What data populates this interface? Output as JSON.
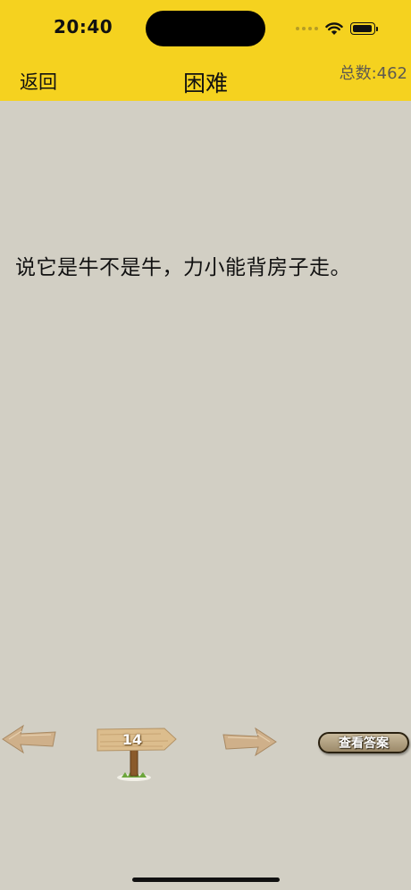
{
  "status_bar": {
    "time": "20:40"
  },
  "nav": {
    "back_label": "返回",
    "title": "困难",
    "total_label": "总数:462"
  },
  "riddle": {
    "text": "说它是牛不是牛，力小能背房子走。"
  },
  "controls": {
    "prev_icon": "left-arrow-icon",
    "next_icon": "right-arrow-icon",
    "level_number": "14",
    "answer_button_label": "查看答案"
  },
  "colors": {
    "header_bg": "#f5d21f",
    "page_bg": "#d2cfc4",
    "wood": "#d9b88a"
  }
}
